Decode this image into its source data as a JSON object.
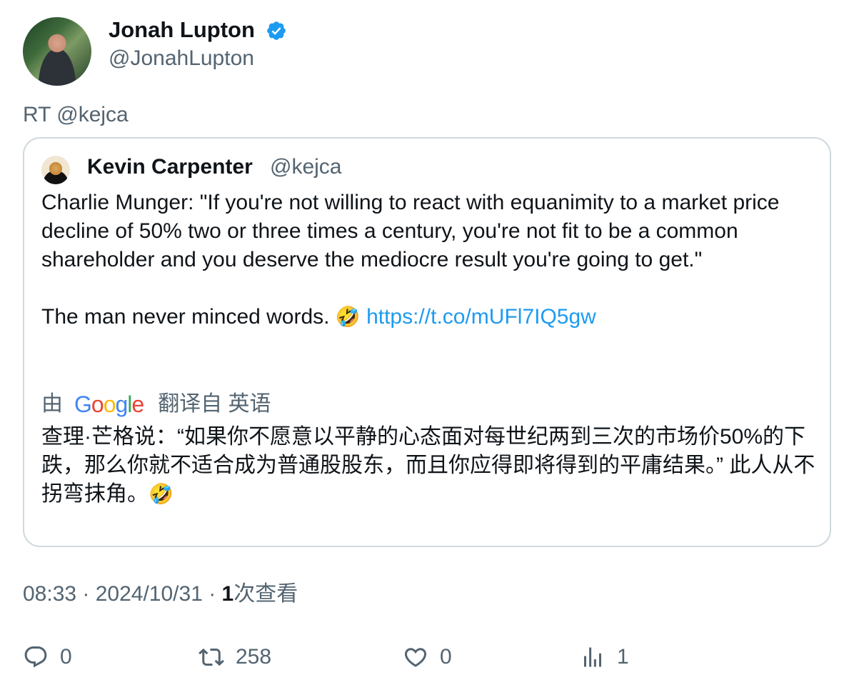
{
  "tweet": {
    "author_name": "Jonah Lupton",
    "author_handle": "@JonahLupton",
    "retweet_label": "RT @kejca",
    "timestamp": "08:33 · 2024/10/31 · ",
    "view_count": "1",
    "view_label": "次查看"
  },
  "quote": {
    "author_name": "Kevin Carpenter",
    "author_handle": "@kejca",
    "paragraph1": "Charlie Munger: \"If you're not willing to react with equanimity to a market price decline of 50% two or three times a century, you're not fit to be a common shareholder and you deserve the mediocre result you're going to get.\"",
    "paragraph2": "The man never minced words. ",
    "emoji": "🤣",
    "link": "https://t.co/mUFl7IQ5gw",
    "translate_by": "由",
    "translate_from": "翻译自 英语",
    "translated_text": "查理·芒格说：“如果你不愿意以平静的心态面对每世纪两到三次的市场价50%的下跌，那么你就不适合成为普通股股东，而且你应得即将得到的平庸结果。” 此人从不拐弯抹角。",
    "translated_emoji": "🤣"
  },
  "actions": {
    "reply_count": "0",
    "retweet_count": "258",
    "like_count": "0",
    "views_count": "1"
  },
  "colors": {
    "link": "#1d9bf0",
    "muted": "#536471",
    "verified": "#1d9bf0",
    "border": "#cfd9de"
  },
  "icons": [
    "verified-badge-icon",
    "reply-icon",
    "retweet-icon",
    "like-icon",
    "views-icon",
    "google-logo"
  ]
}
